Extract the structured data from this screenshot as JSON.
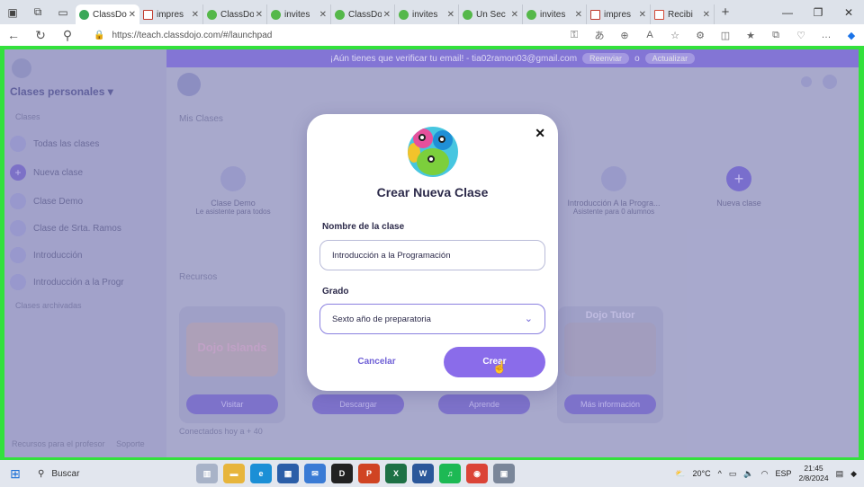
{
  "browser": {
    "tabs": [
      {
        "label": "ClassDo",
        "icon": "classdojo-icon",
        "active": true
      },
      {
        "label": "impres",
        "icon": "pdf-icon"
      },
      {
        "label": "ClassDo",
        "icon": "classdojo-icon"
      },
      {
        "label": "invites",
        "icon": "classdojo-icon"
      },
      {
        "label": "ClassDo",
        "icon": "classdojo-icon"
      },
      {
        "label": "invites",
        "icon": "classdojo-icon"
      },
      {
        "label": "Un Sec",
        "icon": "classdojo-icon"
      },
      {
        "label": "invites",
        "icon": "classdojo-icon"
      },
      {
        "label": "impres",
        "icon": "pdf-icon"
      },
      {
        "label": "Recibi",
        "icon": "gmail-icon"
      }
    ],
    "url": "https://teach.classdojo.com/#/launchpad"
  },
  "banner": {
    "text": "¡Aún tienes que verificar tu email! - tia02ramon03@gmail.com",
    "btn1": "Reenviar",
    "sep": "o",
    "btn2": "Actualizar"
  },
  "sidebar": {
    "title": "Clases personales",
    "section_label": "Clases",
    "items": [
      {
        "label": "Todas las clases"
      },
      {
        "label": "Nueva clase"
      },
      {
        "label": "Clase Demo"
      },
      {
        "label": "Clase de Srta. Ramos"
      },
      {
        "label": "Introducción"
      },
      {
        "label": "Introducción a la Progr"
      }
    ],
    "archived": "Clases archivadas",
    "footer_left": "Recursos para el profesor",
    "footer_right": "Soporte"
  },
  "main": {
    "section_classes": "Mis Clases",
    "cards": [
      {
        "name": "Clase Demo",
        "sub": "Le asistente para todos"
      },
      {
        "name": "Introducción A la Progra...",
        "sub": "Asistente para 0 alumnos"
      },
      {
        "name": "Nueva clase",
        "sub": ""
      }
    ],
    "section_resources": "Recursos",
    "promo_buttons": [
      "Visitar",
      "Descargar",
      "Aprende",
      "Más información"
    ],
    "promo_titles": [
      "Dojo Islands",
      "Dojo Tutor"
    ],
    "footer_link": "Conectados hoy a + 40"
  },
  "modal": {
    "title": "Crear Nueva Clase",
    "name_label": "Nombre de la clase",
    "name_value": "Introducción a la Programación",
    "grade_label": "Grado",
    "grade_value": "Sexto año de preparatoria",
    "cancel_label": "Cancelar",
    "create_label": "Crear"
  },
  "taskbar": {
    "search_label": "Buscar",
    "weather": "20°C",
    "language": "ESP",
    "time": "21:45",
    "date": "2/8/2024"
  },
  "colors": {
    "frame_border": "#33e13c",
    "accent": "#8a6cea",
    "banner": "#8576d8"
  }
}
